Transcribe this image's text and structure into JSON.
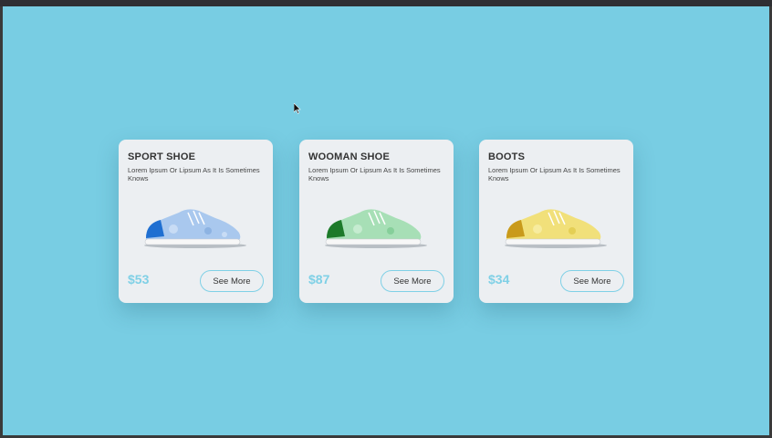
{
  "cards": [
    {
      "title": "SPORT SHOE",
      "description": "Lorem Ipsum Or Lipsum As It Is Sometimes Knows",
      "price": "$53",
      "button": "See More",
      "shoe_color": "#a9c8ee",
      "accent": "#1f6fd1"
    },
    {
      "title": "WOOMAN SHOE",
      "description": "Lorem Ipsum Or Lipsum As It Is Sometimes Knows",
      "price": "$87",
      "button": "See More",
      "shoe_color": "#a7dfb6",
      "accent": "#1d7a2a"
    },
    {
      "title": "BOOTS",
      "description": "Lorem Ipsum Or Lipsum As It Is Sometimes Knows",
      "price": "$34",
      "button": "See More",
      "shoe_color": "#f1e07a",
      "accent": "#c99a1b"
    }
  ],
  "colors": {
    "background": "#78cde3",
    "card": "#eceff2",
    "price": "#7fd0e6"
  }
}
